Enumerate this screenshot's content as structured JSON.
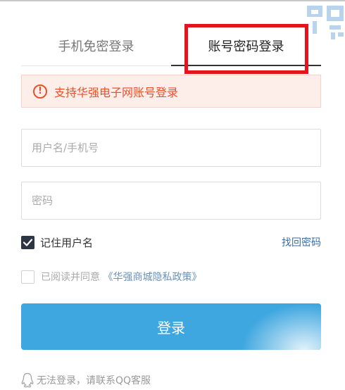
{
  "tabs": [
    {
      "label": "手机免密登录",
      "active": false
    },
    {
      "label": "账号密码登录",
      "active": true
    }
  ],
  "notice": {
    "icon": "exclamation-circle-icon",
    "text": "支持华强电子网账号登录"
  },
  "form": {
    "username_placeholder": "用户名/手机号",
    "password_placeholder": "密码"
  },
  "remember": {
    "label": "记住用户名",
    "checked": true
  },
  "forgot_label": "找回密码",
  "agreement": {
    "prefix": "已阅读并同意",
    "policy": "《华强商城隐私政策》",
    "checked": false
  },
  "login_label": "登录",
  "qq_help": "无法登录，请联系QQ客服",
  "colors": {
    "accent": "#3fa7e0",
    "notice": "#e8502a",
    "highlight": "#e4141f",
    "link": "#3a6ea5"
  }
}
